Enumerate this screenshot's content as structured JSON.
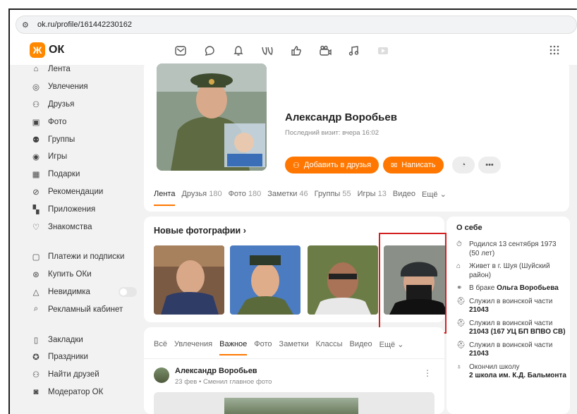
{
  "browser": {
    "url": "ok.ru/profile/161442230162"
  },
  "header": {
    "logo_text": "ОК",
    "logo_glyph": "Ж",
    "icons": [
      "messages-icon",
      "discussions-icon",
      "notifications-icon",
      "guests-icon",
      "likes-icon",
      "video-icon",
      "music-icon"
    ]
  },
  "sidebar": {
    "items": [
      {
        "label": "Лента",
        "icon": "home-icon"
      },
      {
        "label": "Увлечения",
        "icon": "hobby-icon"
      },
      {
        "label": "Друзья",
        "icon": "friends-icon"
      },
      {
        "label": "Фото",
        "icon": "photo-icon"
      },
      {
        "label": "Группы",
        "icon": "groups-icon"
      },
      {
        "label": "Игры",
        "icon": "games-icon"
      },
      {
        "label": "Подарки",
        "icon": "gifts-icon"
      },
      {
        "label": "Рекомендации",
        "icon": "recommendations-icon"
      },
      {
        "label": "Приложения",
        "icon": "apps-icon"
      },
      {
        "label": "Знакомства",
        "icon": "dating-icon"
      }
    ],
    "items2": [
      {
        "label": "Платежи и подписки",
        "icon": "wallet-icon"
      },
      {
        "label": "Купить ОКи",
        "icon": "coin-icon"
      },
      {
        "label": "Невидимка",
        "icon": "invisible-icon"
      },
      {
        "label": "Рекламный кабинет",
        "icon": "ads-icon"
      }
    ],
    "items3": [
      {
        "label": "Закладки",
        "icon": "bookmark-icon"
      },
      {
        "label": "Праздники",
        "icon": "holiday-icon"
      },
      {
        "label": "Найти друзей",
        "icon": "find-friends-icon"
      },
      {
        "label": "Модератор ОК",
        "icon": "moderator-icon"
      }
    ]
  },
  "profile": {
    "name": "Александр Воробьев",
    "last_visit": "Последний визит: вчера 16:02",
    "add_friend_label": "Добавить в друзья",
    "write_label": "Написать",
    "tabs": [
      {
        "label": "Лента",
        "count": ""
      },
      {
        "label": "Друзья",
        "count": "180"
      },
      {
        "label": "Фото",
        "count": "180"
      },
      {
        "label": "Заметки",
        "count": "46"
      },
      {
        "label": "Группы",
        "count": "55"
      },
      {
        "label": "Игры",
        "count": "13"
      },
      {
        "label": "Видео",
        "count": ""
      },
      {
        "label": "Ещё",
        "count": ""
      }
    ]
  },
  "photos": {
    "title": "Новые фотографии ›"
  },
  "about": {
    "title": "О себе",
    "born": "Родился 13 сентября 1973 (50 лет)",
    "lives": "Живет в г. Шуя (Шуйский район)",
    "married_prefix": "В браке ",
    "married_name": "Ольга Воробьева",
    "served_label": "Служил в воинской части",
    "unit1": "21043",
    "unit2": "21043 (167 УЦ БП ВПВО СВ)",
    "unit3": "21043",
    "school_label": "Окончил школу",
    "school_name": "2 школа им. К.Д. Бальмонта"
  },
  "feed": {
    "tabs": [
      "Всё",
      "Увлечения",
      "Важное",
      "Фото",
      "Заметки",
      "Классы",
      "Видео",
      "Ещё"
    ],
    "post_author": "Александр Воробьев",
    "post_meta": "23 фев • Сменил главное фото"
  },
  "colors": {
    "accent": "#ff7700",
    "highlight": "#d42020"
  }
}
